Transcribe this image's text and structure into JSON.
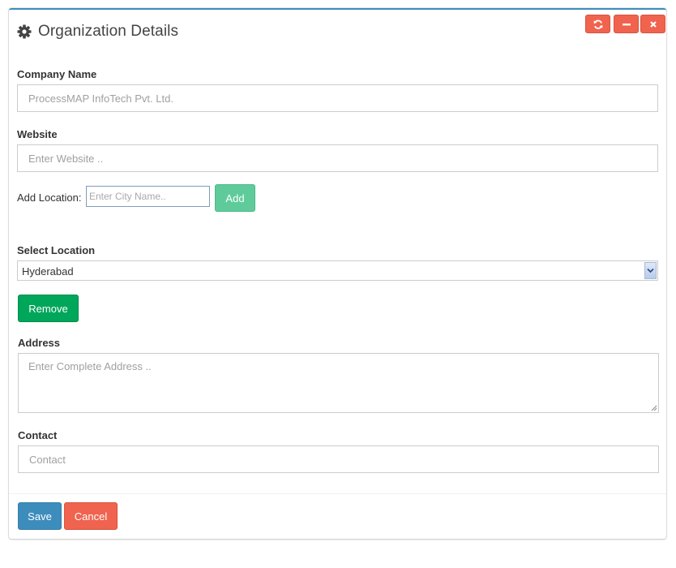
{
  "header": {
    "title": "Organization Details",
    "icon": "gear-icon"
  },
  "toolbar": {
    "refresh_icon": "refresh-icon",
    "minimize_icon": "minus-icon",
    "close_icon": "close-icon"
  },
  "form": {
    "company_name": {
      "label": "Company Name",
      "placeholder": "ProcessMAP InfoTech Pvt. Ltd."
    },
    "website": {
      "label": "Website",
      "placeholder": "Enter Website .."
    },
    "add_location": {
      "label": "Add Location:",
      "placeholder": "Enter City Name..",
      "button": "Add"
    },
    "select_location": {
      "label": "Select Location",
      "selected": "Hyderabad",
      "remove_button": "Remove"
    },
    "address": {
      "label": "Address",
      "placeholder": "Enter Complete Address .."
    },
    "contact": {
      "label": "Contact",
      "placeholder": "Contact"
    }
  },
  "footer": {
    "save_label": "Save",
    "cancel_label": "Cancel"
  },
  "colors": {
    "primary": "#3c8dbc",
    "danger": "#f0634e",
    "success": "#00a65a",
    "success_light": "#5fcb9b"
  }
}
